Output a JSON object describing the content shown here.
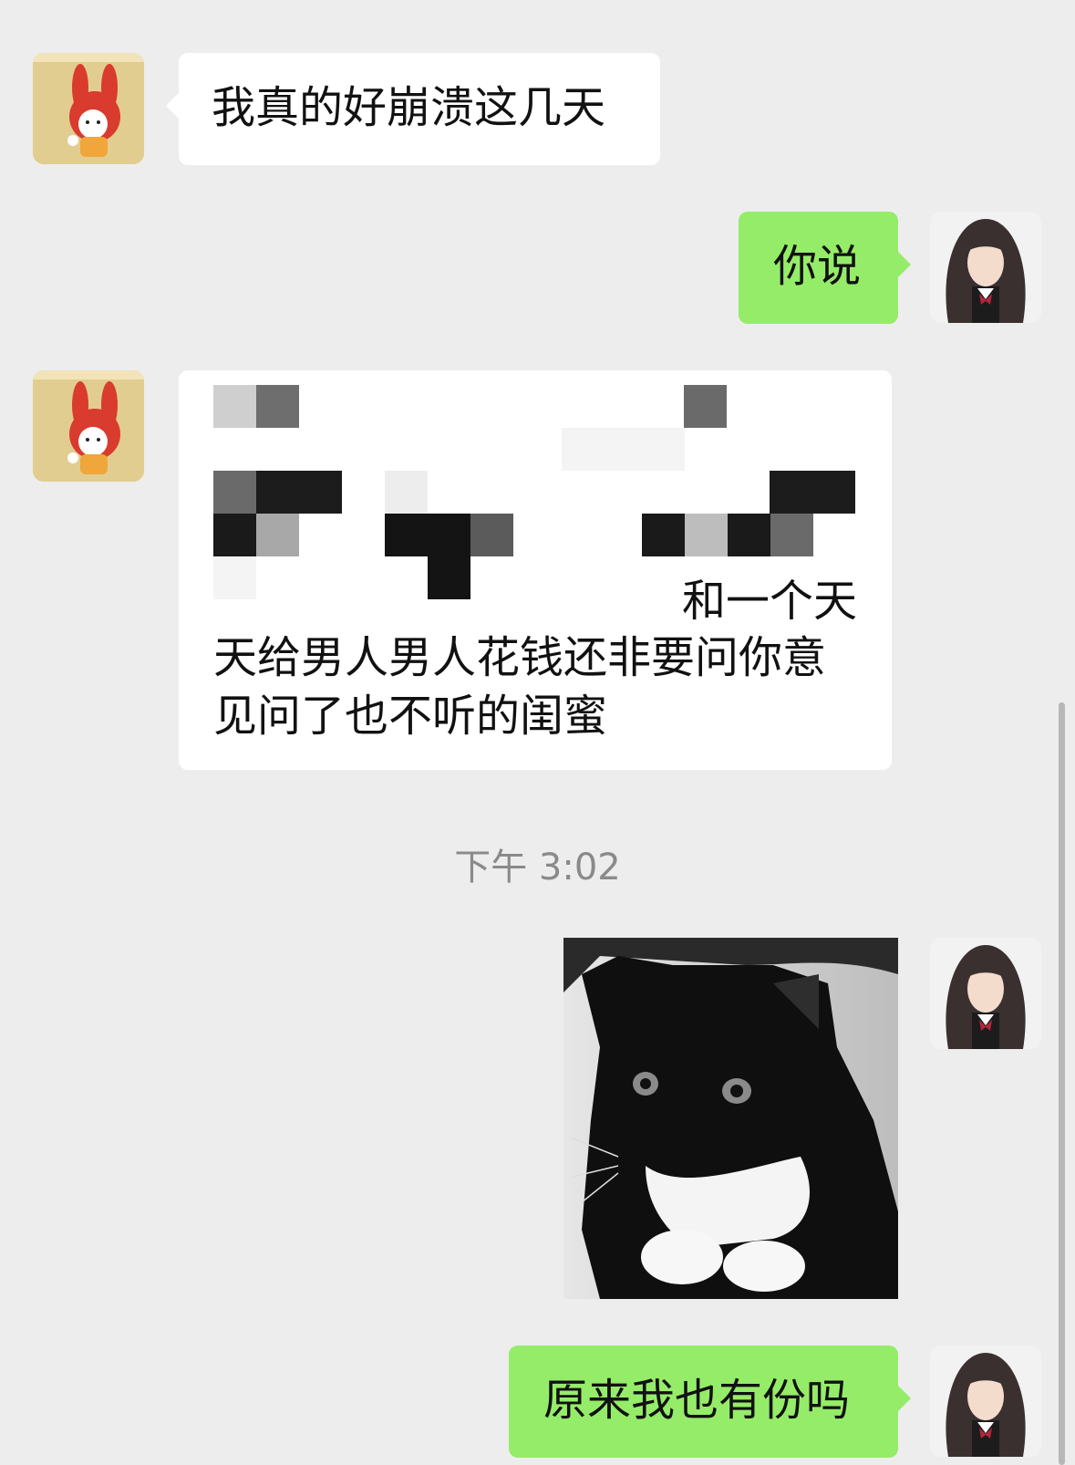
{
  "messages": [
    {
      "from": "other",
      "text": "我真的好崩溃这几天"
    },
    {
      "from": "me",
      "text": "你说"
    },
    {
      "from": "other",
      "lines": [
        "和一个天",
        "天给男人男人花钱还非要问你意",
        "见问了也不听的闺蜜"
      ]
    },
    {
      "from": "me",
      "type": "image",
      "image_icon": "cat-photo"
    },
    {
      "from": "me",
      "text": "原来我也有份吗"
    }
  ],
  "timestamp": "下午 3:02",
  "colors": {
    "background": "#ededed",
    "incoming": "#ffffff",
    "outgoing": "#95ec69",
    "timestamp": "#8a8a8a"
  },
  "avatars": {
    "other": "bunny-avatar",
    "me": "girl-avatar"
  }
}
